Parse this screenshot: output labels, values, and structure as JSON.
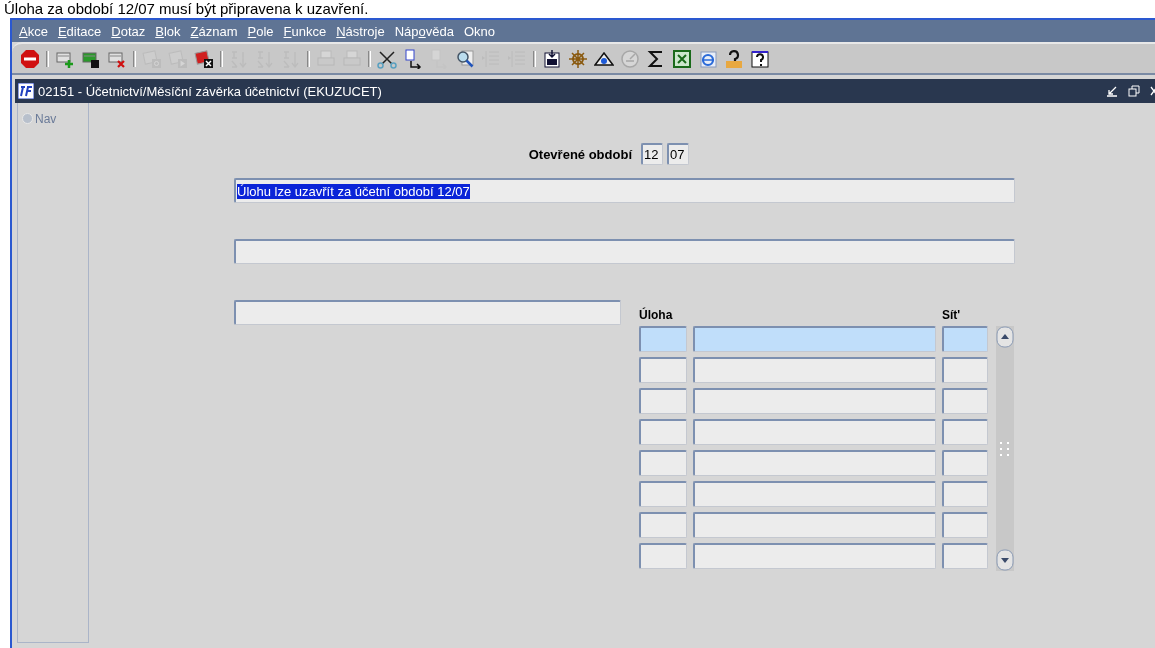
{
  "message": "Úloha za období 12/07 musí být připravena k uzavření.",
  "menu": [
    {
      "key": "A",
      "post": "kce"
    },
    {
      "key": "E",
      "post": "ditace"
    },
    {
      "key": "D",
      "post": "otaz"
    },
    {
      "key": "B",
      "post": "lok"
    },
    {
      "key": "Z",
      "post": "áznam"
    },
    {
      "key": "P",
      "post": "ole"
    },
    {
      "key": "F",
      "post": "unkce"
    },
    {
      "key": "N",
      "post": "ástroje"
    },
    {
      "pre": "Náp",
      "key": "o",
      "post": "věda"
    },
    {
      "pre": "Okno"
    }
  ],
  "toolbar": [
    {
      "kind": "exit",
      "disabled": false
    },
    {
      "kind": "separator"
    },
    {
      "kind": "insert",
      "disabled": false
    },
    {
      "kind": "duplicate",
      "disabled": false
    },
    {
      "kind": "delete",
      "disabled": false
    },
    {
      "kind": "separator"
    },
    {
      "kind": "query",
      "disabled": true
    },
    {
      "kind": "execute",
      "disabled": true
    },
    {
      "kind": "cancel",
      "disabled": false
    },
    {
      "kind": "separator"
    },
    {
      "kind": "sort-asc",
      "disabled": true
    },
    {
      "kind": "sort-desc",
      "disabled": true
    },
    {
      "kind": "sort-multi",
      "disabled": true
    },
    {
      "kind": "separator"
    },
    {
      "kind": "print",
      "disabled": true
    },
    {
      "kind": "print-setup",
      "disabled": true
    },
    {
      "kind": "separator"
    },
    {
      "kind": "cut",
      "disabled": false
    },
    {
      "kind": "copy",
      "disabled": false
    },
    {
      "kind": "paste",
      "disabled": true
    },
    {
      "kind": "find",
      "disabled": false
    },
    {
      "kind": "list",
      "disabled": true
    },
    {
      "kind": "columns",
      "disabled": true
    },
    {
      "kind": "separator"
    },
    {
      "kind": "document",
      "disabled": false
    },
    {
      "kind": "wheel",
      "disabled": false
    },
    {
      "kind": "eye",
      "disabled": false
    },
    {
      "kind": "clock",
      "disabled": true
    },
    {
      "kind": "sigma",
      "disabled": false
    },
    {
      "kind": "excel",
      "disabled": false
    },
    {
      "kind": "browser",
      "disabled": false
    },
    {
      "kind": "help-key",
      "disabled": false
    },
    {
      "kind": "help",
      "disabled": false
    }
  ],
  "window": {
    "title": "02151 - Účetnictví/Měsíční závěrka účetnictví (EKUZUCET)"
  },
  "nav": {
    "label": "Nav",
    "selected": false
  },
  "form": {
    "period_label": "Otevřené období",
    "period": [
      "12",
      "07"
    ],
    "status_field": {
      "value": "Úlohu lze uzavřít za účetní období 12/07",
      "selected": true
    }
  },
  "table": {
    "columns": [
      "Úloha",
      "",
      "Sít'"
    ],
    "rows": [
      {
        "selected": true
      },
      {
        "selected": false
      },
      {
        "selected": false
      },
      {
        "selected": false
      },
      {
        "selected": false
      },
      {
        "selected": false
      },
      {
        "selected": false
      },
      {
        "selected": false
      }
    ]
  }
}
